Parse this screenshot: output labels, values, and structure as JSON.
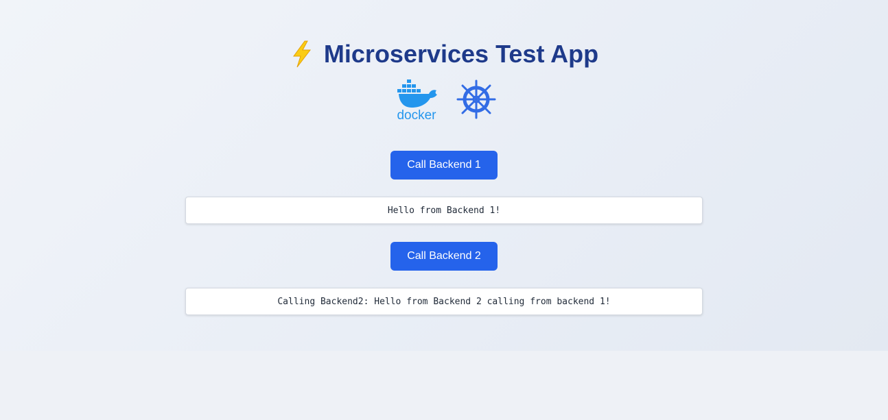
{
  "header": {
    "title": "Microservices Test App",
    "icon": "lightning-bolt-icon"
  },
  "logos": {
    "docker_label": "docker",
    "kubernetes": "kubernetes-helm-icon"
  },
  "backend1": {
    "button_label": "Call Backend 1",
    "result": "Hello from Backend 1!"
  },
  "backend2": {
    "button_label": "Call Backend 2",
    "result": "Calling Backend2: Hello from Backend 2 calling from backend 1!"
  },
  "colors": {
    "primary": "#2563eb",
    "title": "#1e3a8a",
    "docker": "#2496ed",
    "kubernetes": "#326ce5",
    "bolt": "#facc15"
  }
}
